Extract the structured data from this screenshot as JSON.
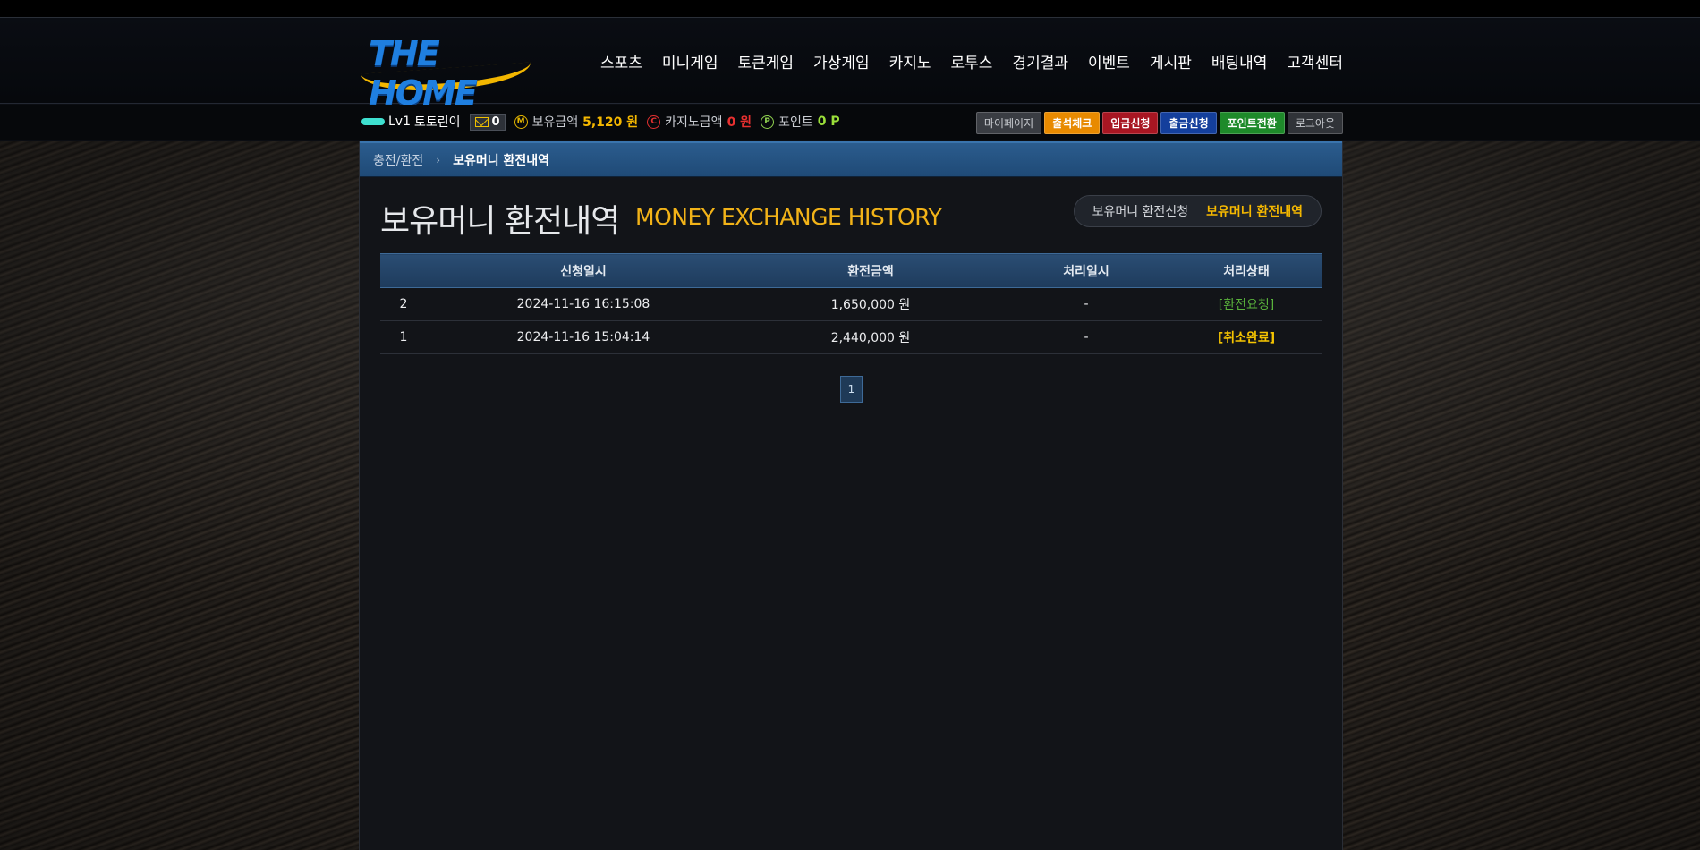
{
  "header": {
    "logo_text": "THE HOME",
    "nav": [
      "스포츠",
      "미니게임",
      "토큰게임",
      "가상게임",
      "카지노",
      "로투스",
      "경기결과",
      "이벤트",
      "게시판",
      "배팅내역",
      "고객센터"
    ]
  },
  "user": {
    "level": "Lv1",
    "name": "토토린이",
    "messages": "0",
    "money_label": "보유금액",
    "money_value": "5,120 원",
    "casino_label": "카지노금액",
    "casino_value": "0 원",
    "point_label": "포인트",
    "point_value": "0 P"
  },
  "top_buttons": [
    "마이페이지",
    "출석체크",
    "입금신청",
    "출금신청",
    "포인트전환",
    "로그아웃"
  ],
  "breadcrumb": {
    "parent": "충전/환전",
    "current": "보유머니 환전내역"
  },
  "page": {
    "title_ko": "보유머니 환전내역",
    "title_en": "MONEY EXCHANGE HISTORY",
    "tabs": [
      {
        "label": "보유머니 환전신청",
        "active": false
      },
      {
        "label": "보유머니 환전내역",
        "active": true
      }
    ]
  },
  "table": {
    "columns": [
      "",
      "신청일시",
      "환전금액",
      "처리일시",
      "처리상태"
    ],
    "rows": [
      {
        "no": "2",
        "date": "2024-11-16 16:15:08",
        "amount": "1,650,000 원",
        "processed": "-",
        "status": "[환전요청]"
      },
      {
        "no": "1",
        "date": "2024-11-16 15:04:14",
        "amount": "2,440,000 원",
        "processed": "-",
        "status": "[취소완료]"
      }
    ]
  },
  "pagination": {
    "current": "1"
  },
  "colors": {
    "accent": "#f5b800",
    "header_blue": "#2b5c8e",
    "status_request": "#5ab33c",
    "status_cancel": "#f5c400"
  }
}
